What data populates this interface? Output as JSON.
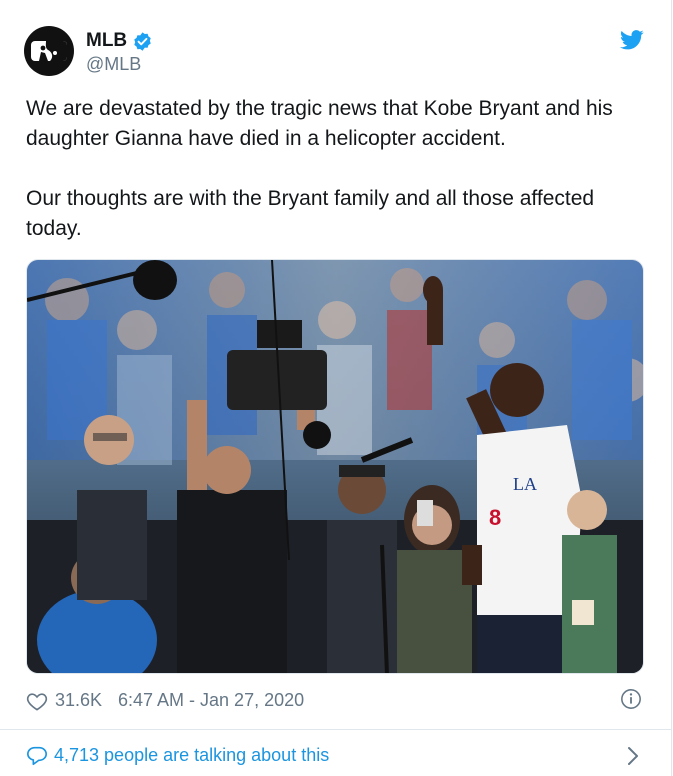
{
  "account": {
    "display_name": "MLB",
    "handle": "@MLB",
    "verified": true,
    "avatar_icon": "mlb-logo-icon"
  },
  "tweet": {
    "paragraphs": [
      "We are devastated by the tragic news that Kobe Bryant and his daughter Gianna have died in a helicopter accident.",
      "Our thoughts are with the Bryant family and all those affected today."
    ]
  },
  "media": {
    "icon": "photo-kobe-bryant-dodger-stadium"
  },
  "footer": {
    "likes": "31.6K",
    "timestamp": "6:47 AM - Jan 27, 2020",
    "talking": "4,713 people are talking about this"
  },
  "colors": {
    "twitter_blue": "#1da1f2",
    "link_blue": "#1b95e0",
    "muted": "#657786",
    "text": "#14171a",
    "border": "#e1e8ed"
  },
  "icons": [
    "verified-badge-icon",
    "twitter-bird-icon",
    "heart-icon",
    "info-icon",
    "speech-bubble-icon",
    "chevron-right-icon"
  ]
}
